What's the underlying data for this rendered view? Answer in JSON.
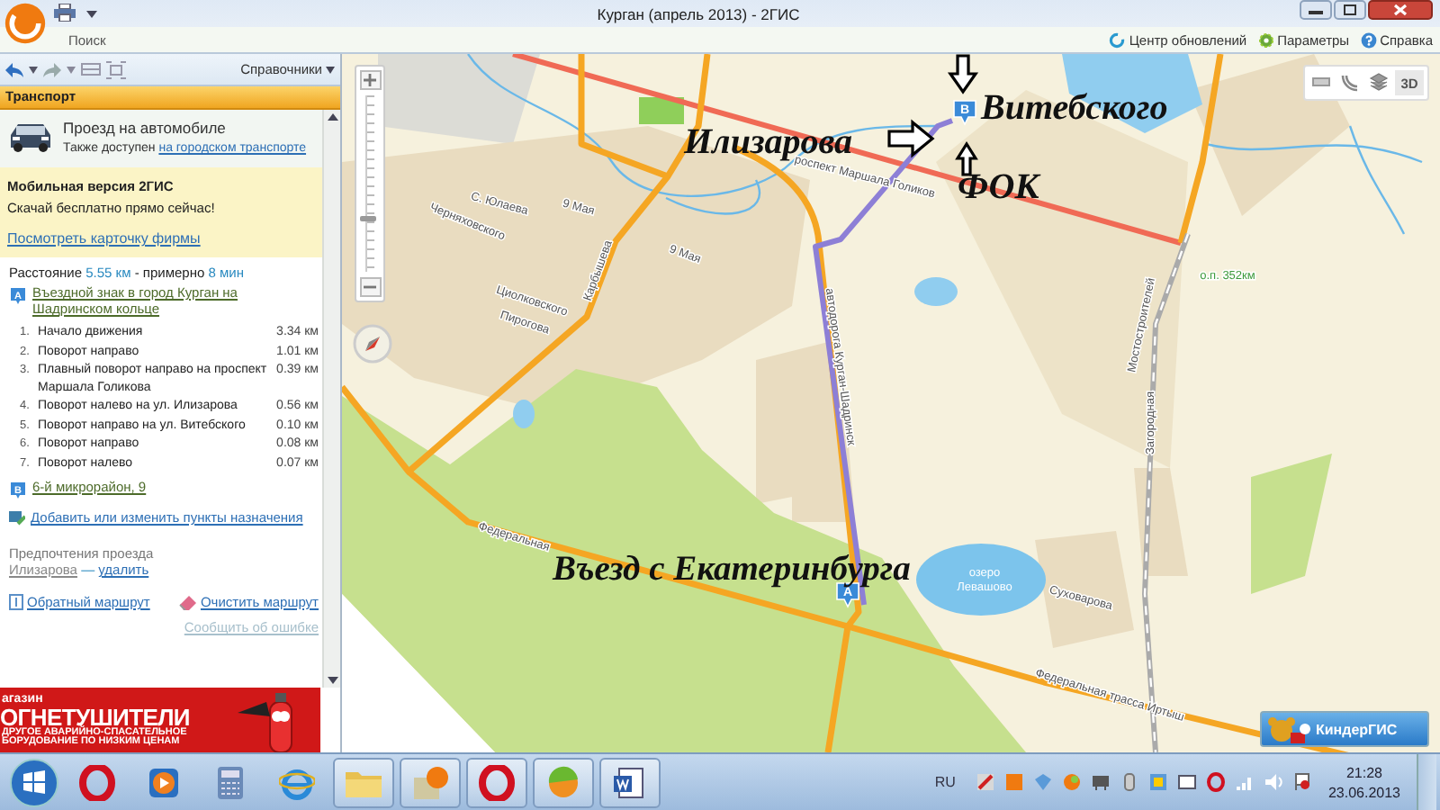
{
  "window": {
    "title": "Курган (апрель 2013) - 2ГИС"
  },
  "ribbon": {
    "tabs": [
      {
        "label": "Поиск"
      }
    ],
    "links": [
      {
        "label": "Центр обновлений",
        "kind": "update"
      },
      {
        "label": "Параметры",
        "kind": "settings"
      },
      {
        "label": "Справка",
        "kind": "help"
      }
    ]
  },
  "sidebar": {
    "directories_button": "Справочники",
    "section_title": "Транспорт",
    "mode": {
      "title": "Проезд на автомобиле",
      "note": "Также доступен",
      "link": "на городском транспорте"
    },
    "promo": {
      "title": "Мобильная версия 2ГИС",
      "text": "Скачай бесплатно прямо сейчас!",
      "link": "Посмотреть карточку фирмы"
    },
    "summary": {
      "label": "Расстояние",
      "distance": "5.55 км",
      "separator": "- примерно",
      "duration": "8 мин"
    },
    "start": {
      "marker": "A",
      "name": "Въездной знак в город Курган на Шадринском кольце"
    },
    "steps": [
      {
        "number": "1.",
        "text": "Начало движения",
        "distance": "3.34 км"
      },
      {
        "number": "2.",
        "text": "Поворот направо",
        "distance": "1.01 км"
      },
      {
        "number": "3.",
        "text": "Плавный поворот направо на проспект Маршала Голикова",
        "distance": "0.39 км"
      },
      {
        "number": "4.",
        "text": "Поворот налево на ул. Илизарова",
        "distance": "0.56 км"
      },
      {
        "number": "5.",
        "text": "Поворот направо на ул. Витебского",
        "distance": "0.10 км"
      },
      {
        "number": "6.",
        "text": "Поворот направо",
        "distance": "0.08 км"
      },
      {
        "number": "7.",
        "text": "Поворот налево",
        "distance": "0.07 км"
      }
    ],
    "finish": {
      "marker": "B",
      "name": "6-й микрорайон, 9"
    },
    "add_link": "Добавить или изменить пункты назначения",
    "preferences": {
      "title": "Предпочтения проезда",
      "street": "Илизарова",
      "separator": "—",
      "delete_link": "удалить"
    },
    "actions": [
      {
        "label": "Обратный маршрут",
        "kind": "reverse"
      },
      {
        "label": "Очистить маршрут",
        "kind": "clear"
      }
    ],
    "report_link": "Сообщить об ошибке",
    "ad": {
      "lines": [
        "агазин",
        "ОГНЕТУШИТЕЛИ",
        "ДРУГОЕ АВАРИЙНО-СПАСАТЕЛЬНОЕ",
        "БОРУДОВАНИЕ ПО НИЗКИМ ЦЕНАМ"
      ]
    }
  },
  "map": {
    "zoom": {
      "level": 0.3
    },
    "view_buttons": [
      {
        "kind": "ruler"
      },
      {
        "kind": "radius"
      },
      {
        "kind": "layers"
      },
      {
        "kind": "label",
        "label": "3D"
      }
    ],
    "street_labels": [
      {
        "text": "С. Юлаева",
        "kind": "street"
      },
      {
        "text": "9 Мая",
        "kind": "street"
      },
      {
        "text": "Черняховского",
        "kind": "street"
      },
      {
        "text": "Карбышева",
        "kind": "street"
      },
      {
        "text": "9 Мая",
        "kind": "street"
      },
      {
        "text": "Циолковского",
        "kind": "street"
      },
      {
        "text": "Пирогова",
        "kind": "street"
      },
      {
        "text": "роспект Маршала Голиков",
        "kind": "street"
      },
      {
        "text": "автодорога Курган-Шадринск",
        "kind": "street"
      },
      {
        "text": "Мостостроителей",
        "kind": "street"
      },
      {
        "text": "Загородная",
        "kind": "street"
      },
      {
        "text": "о.п. 352км",
        "kind": "station"
      },
      {
        "text": "Суховарова",
        "kind": "street"
      },
      {
        "text": "Федеральная",
        "kind": "street"
      },
      {
        "text": "Федеральная трасса Иртыш",
        "kind": "street"
      }
    ],
    "water_labels": [
      {
        "lines": [
          "озеро",
          "Левашово"
        ]
      }
    ],
    "markers": [
      {
        "label": "A"
      },
      {
        "label": "B"
      }
    ],
    "annotations": [
      {
        "text": "Витебского"
      },
      {
        "text": "Илизарова"
      },
      {
        "text": "ФОК"
      },
      {
        "text": "Въезд с Екатеринбурга"
      }
    ],
    "kinder_button": "КиндерГИС"
  },
  "taskbar": {
    "apps": [
      {
        "kind": "opera",
        "running": false
      },
      {
        "kind": "media",
        "running": false
      },
      {
        "kind": "calc",
        "running": false
      },
      {
        "kind": "ie",
        "running": false
      },
      {
        "kind": "folder",
        "running": true
      },
      {
        "kind": "gis",
        "running": true
      },
      {
        "kind": "opera",
        "running": true
      },
      {
        "kind": "ball",
        "running": true
      },
      {
        "kind": "word",
        "running": true
      }
    ],
    "language": "RU",
    "time": "21:28",
    "date": "23.06.2013"
  }
}
